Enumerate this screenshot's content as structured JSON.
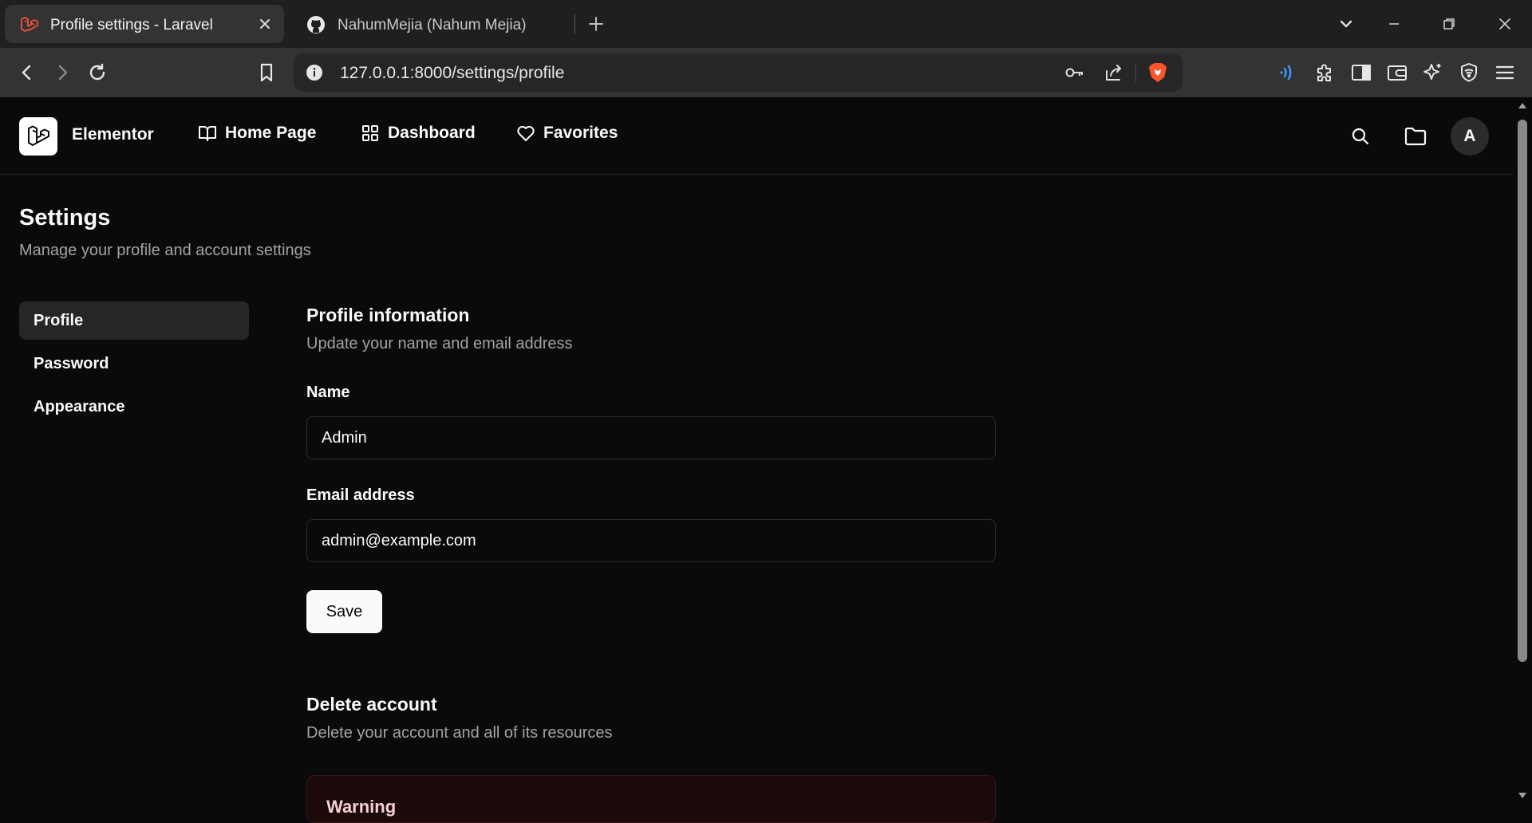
{
  "browser": {
    "tabs": [
      {
        "title": "Profile settings - Laravel",
        "favicon": "laravel-icon",
        "active": true
      },
      {
        "title": "NahumMejia (Nahum Mejia)",
        "favicon": "github-icon",
        "active": false
      }
    ],
    "url": "127.0.0.1:8000/settings/profile",
    "brave_color": "#fb542b",
    "accent_color": "#3b9cff"
  },
  "header": {
    "brand": "Elementor",
    "nav": [
      {
        "label": "Home Page",
        "icon": "book-open-icon"
      },
      {
        "label": "Dashboard",
        "icon": "layout-grid-icon"
      },
      {
        "label": "Favorites",
        "icon": "heart-icon"
      }
    ],
    "avatar_initial": "A"
  },
  "settings": {
    "title": "Settings",
    "subtitle": "Manage your profile and account settings",
    "sidebar": [
      {
        "label": "Profile",
        "active": true
      },
      {
        "label": "Password",
        "active": false
      },
      {
        "label": "Appearance",
        "active": false
      }
    ]
  },
  "profile": {
    "title": "Profile information",
    "subtitle": "Update your name and email address",
    "name_label": "Name",
    "name_value": "Admin",
    "email_label": "Email address",
    "email_value": "admin@example.com",
    "save_label": "Save"
  },
  "delete": {
    "title": "Delete account",
    "subtitle": "Delete your account and all of its resources",
    "warning_title": "Warning"
  }
}
